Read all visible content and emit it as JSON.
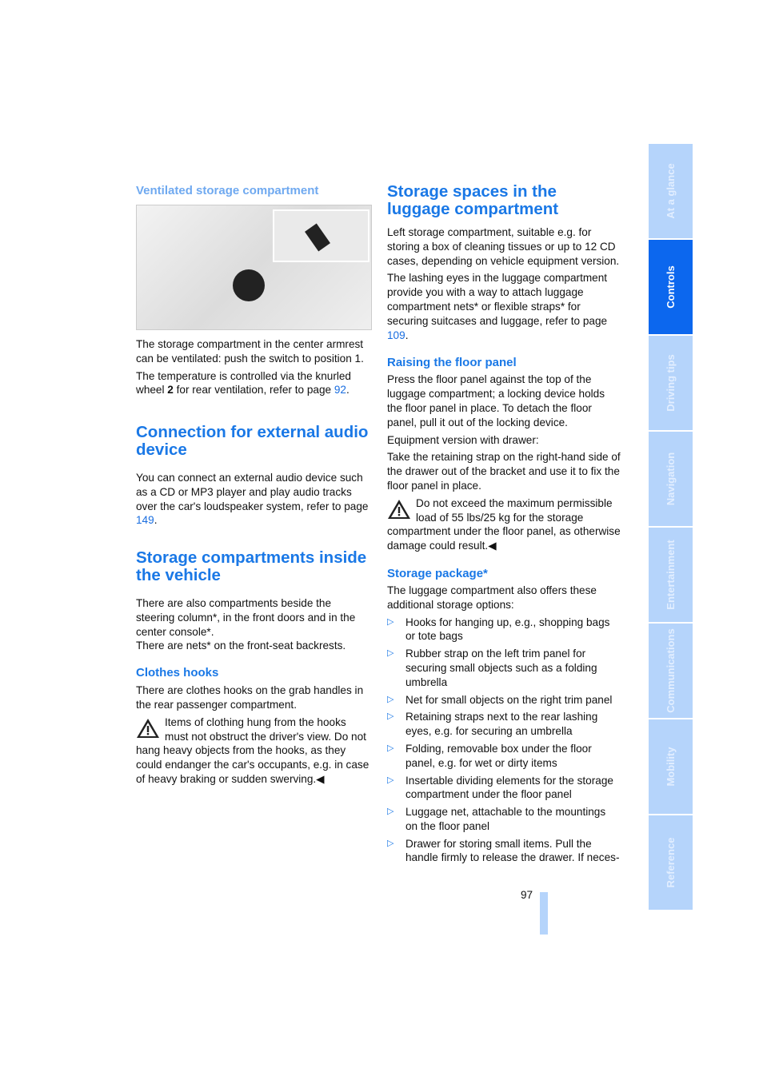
{
  "left": {
    "vent_heading": "Ventilated storage compartment",
    "vent_p1": "The storage compartment in the center armrest can be ventilated: push the switch to position 1.",
    "vent_p2a": "The temperature is controlled via the knurled wheel ",
    "vent_p2b": "2",
    "vent_p2c": " for rear ventilation, refer to page ",
    "vent_p2link": "92",
    "audio_heading": "Connection for external audio device",
    "audio_p": "You can connect an external audio device such as a CD or MP3 player and play audio tracks over the car's loudspeaker system, refer to page ",
    "audio_link": "149",
    "inside_heading": "Storage compartments inside the vehicle",
    "inside_p1": "There are also compartments beside the steering column*, in the front doors and in the center console*.",
    "inside_p2": "There are nets* on the front-seat backrests.",
    "hooks_heading": "Clothes hooks",
    "hooks_p": "There are clothes hooks on the grab handles in the rear passenger compartment.",
    "hooks_warn": "Items of clothing hung from the hooks must not obstruct the driver's view. Do not hang heavy objects from the hooks, as they could endanger the car's occupants, e.g. in case of heavy braking or sudden swerving.◀"
  },
  "right": {
    "luggage_heading": "Storage spaces in the luggage compartment",
    "luggage_p1": "Left storage compartment, suitable e.g. for storing a box of cleaning tissues or up to 12 CD cases, depending on vehicle equipment version.",
    "luggage_p2": "The lashing eyes in the luggage compartment provide you with a way to attach luggage compartment nets* or flexible straps* for securing suitcases and luggage, refer to page ",
    "luggage_link": "109",
    "floor_heading": "Raising the floor panel",
    "floor_p1": "Press the floor panel against the top of the luggage compartment; a locking device holds the floor panel in place. To detach the floor panel, pull it out of the locking device.",
    "floor_p2": "Equipment version with drawer:",
    "floor_p3": "Take the retaining strap on the right-hand side of the drawer out of the bracket and use it to fix the floor panel in place.",
    "floor_warn": "Do not exceed the maximum permissible load of 55 lbs/25 kg for the storage compartment under the floor panel, as otherwise damage could result.◀",
    "package_heading": "Storage package*",
    "package_p": "The luggage compartment also offers these additional storage options:",
    "items": [
      "Hooks for hanging up, e.g., shopping bags or tote bags",
      "Rubber strap on the left trim panel for securing small objects such as a folding umbrella",
      "Net for small objects on the right trim panel",
      "Retaining straps next to the rear lashing eyes, e.g. for securing an umbrella",
      "Folding, removable box under the floor panel, e.g. for wet or dirty items",
      "Insertable dividing elements for the storage compartment under the floor panel",
      "Luggage net, attachable to the mountings on the floor panel",
      "Drawer for storing small items. Pull the handle firmly to release the drawer. If neces-"
    ]
  },
  "page_number": "97",
  "tabs": [
    {
      "label": "At a glance",
      "active": false
    },
    {
      "label": "Controls",
      "active": true
    },
    {
      "label": "Driving tips",
      "active": false
    },
    {
      "label": "Navigation",
      "active": false
    },
    {
      "label": "Entertainment",
      "active": false
    },
    {
      "label": "Communications",
      "active": false
    },
    {
      "label": "Mobility",
      "active": false
    },
    {
      "label": "Reference",
      "active": false
    }
  ],
  "colors": {
    "heading": "#1a78e6",
    "tab": "#b5d4fb",
    "tab_active": "#0c67ee"
  }
}
